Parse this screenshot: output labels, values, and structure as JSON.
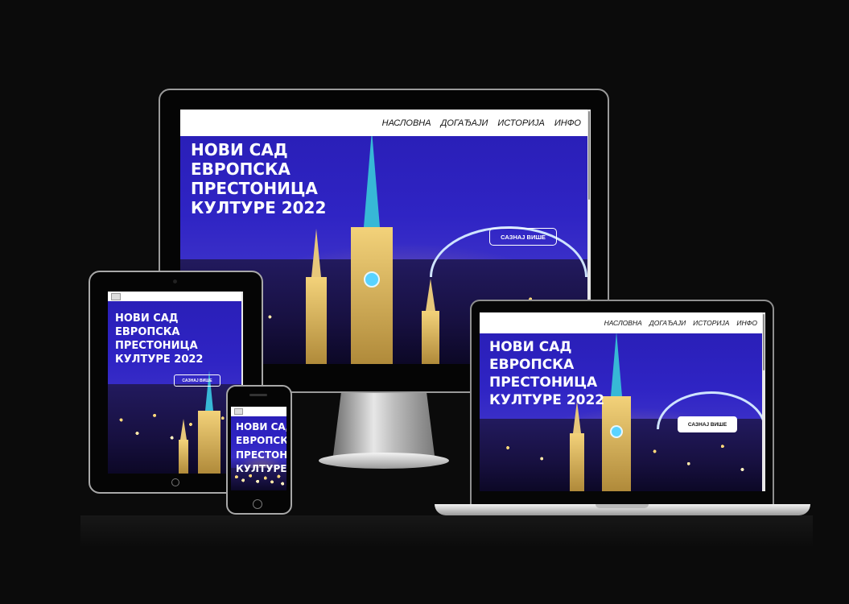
{
  "site": {
    "nav": [
      "НАСЛОВНА",
      "ДОГАЂАЈИ",
      "ИСТОРИЈА",
      "ИНФО"
    ],
    "hero_lines": [
      "НОВИ САД",
      "ЕВРОПСКА",
      "ПРЕСТОНИЦА",
      "КУЛТУРЕ 2022"
    ],
    "cta_label": "САЗНАЈ ВИШЕ"
  },
  "devices": [
    "desktop-monitor",
    "laptop",
    "tablet",
    "phone"
  ],
  "colors": {
    "background": "#0b0b0b",
    "hero_blue": "#2f24c4",
    "nav_bg": "#ffffff"
  }
}
